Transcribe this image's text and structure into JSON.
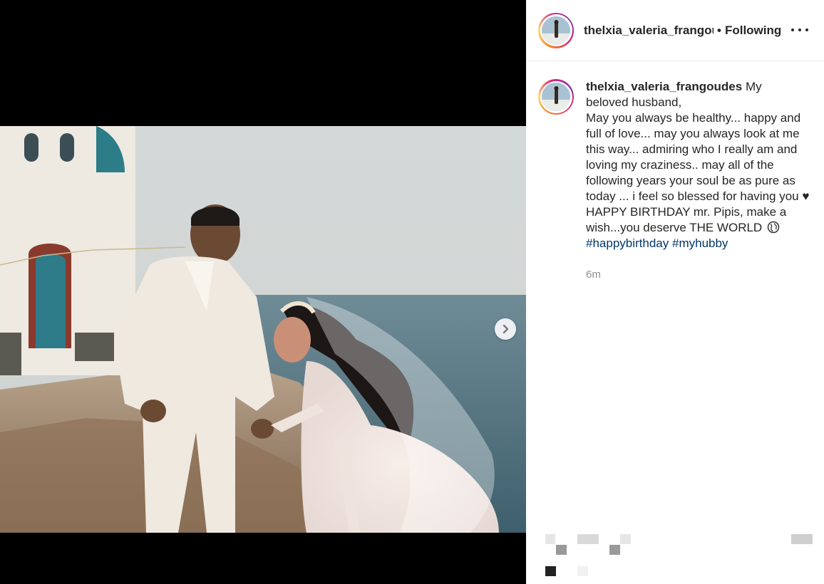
{
  "post": {
    "username": "thelxia_valeria_frangoudes",
    "header_username": "thelxia_valeria_frangou",
    "follow_separator": "•",
    "follow_status": "Following",
    "caption_lines": [
      "My",
      "beloved husband,",
      "May you always be healthy... happy and full of love... may you always look at me this way... admiring who I really am and loving my craziness.. may all of the following years your soul be as pure as today ... i feel so blessed for having you ♥ HAPPY BIRTHDAY mr. Pipis, make a wish...you deserve THE WORLD"
    ],
    "hashtags": [
      "#happybirthday",
      "#myhubby"
    ],
    "timestamp": "6m"
  },
  "icons": {
    "more": "more-options-icon",
    "next": "chevron-right-icon",
    "globe": "globe-emoji-icon"
  },
  "colors": {
    "hashtag": "#00376b",
    "text": "#262626",
    "muted": "#8e8e8e"
  }
}
